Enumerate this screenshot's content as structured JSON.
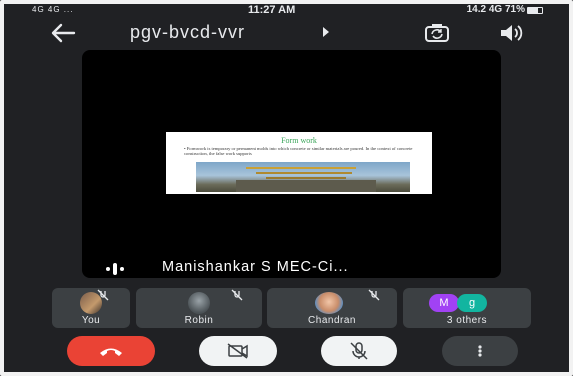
{
  "status_bar": {
    "signal_left": "4G 4G ...",
    "time": "11:27 AM",
    "right_info": "14.2 4G 71%",
    "battery_level": 0.71
  },
  "app_bar": {
    "meeting_code": "pgv-bvcd-vvr"
  },
  "presentation": {
    "slide_title": "Form work",
    "slide_text": "• Formwork is temporary or permanent molds into which concrete or similar materials are poured. In the context of concrete construction, the false work supports",
    "presenter": "Manishankar S MEC-Ci..."
  },
  "participants": [
    {
      "name": "You"
    },
    {
      "name": "Robin"
    },
    {
      "name": "Chandran"
    },
    {
      "name": "3 others",
      "chips": [
        "M",
        "g"
      ]
    }
  ],
  "colors": {
    "background": "#202124",
    "tile": "#3c4043",
    "end_call": "#ea4335",
    "chip_m": "#a142f4",
    "chip_g": "#12b5a0",
    "slide_heading": "#3aa55a"
  },
  "icons": {
    "back": "arrow-left-icon",
    "camera_switch": "camera-flip-icon",
    "speaker": "speaker-icon",
    "end_call": "phone-hangup-icon",
    "camera_off": "camera-off-icon",
    "mic_off": "mic-off-icon",
    "more": "more-vert-icon"
  }
}
